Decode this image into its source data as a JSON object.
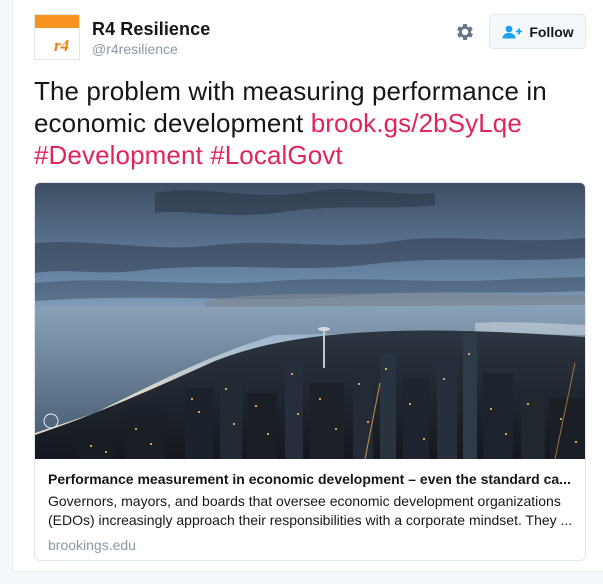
{
  "author": {
    "display_name": "R4 Resilience",
    "screen_name": "@r4resilience",
    "avatar_text": "r4",
    "avatar_color": "#f7931e"
  },
  "actions": {
    "settings_icon": "gear-icon",
    "follow_icon": "add-user-icon",
    "follow_label": "Follow"
  },
  "tweet": {
    "text": "The problem with measuring performance in economic development",
    "link": "brook.gs/2bSyLqe",
    "hashtags": [
      "#Development",
      "#LocalGovt"
    ],
    "accent_color": "#e0245e"
  },
  "card": {
    "image_icon": "city-skyline-photo",
    "title": "Performance measurement in economic development – even the standard ca...",
    "description": "Governors, mayors, and boards that oversee economic development organizations (EDOs) increasingly approach their responsibilities with a corporate mindset. They ...",
    "domain": "brookings.edu"
  }
}
